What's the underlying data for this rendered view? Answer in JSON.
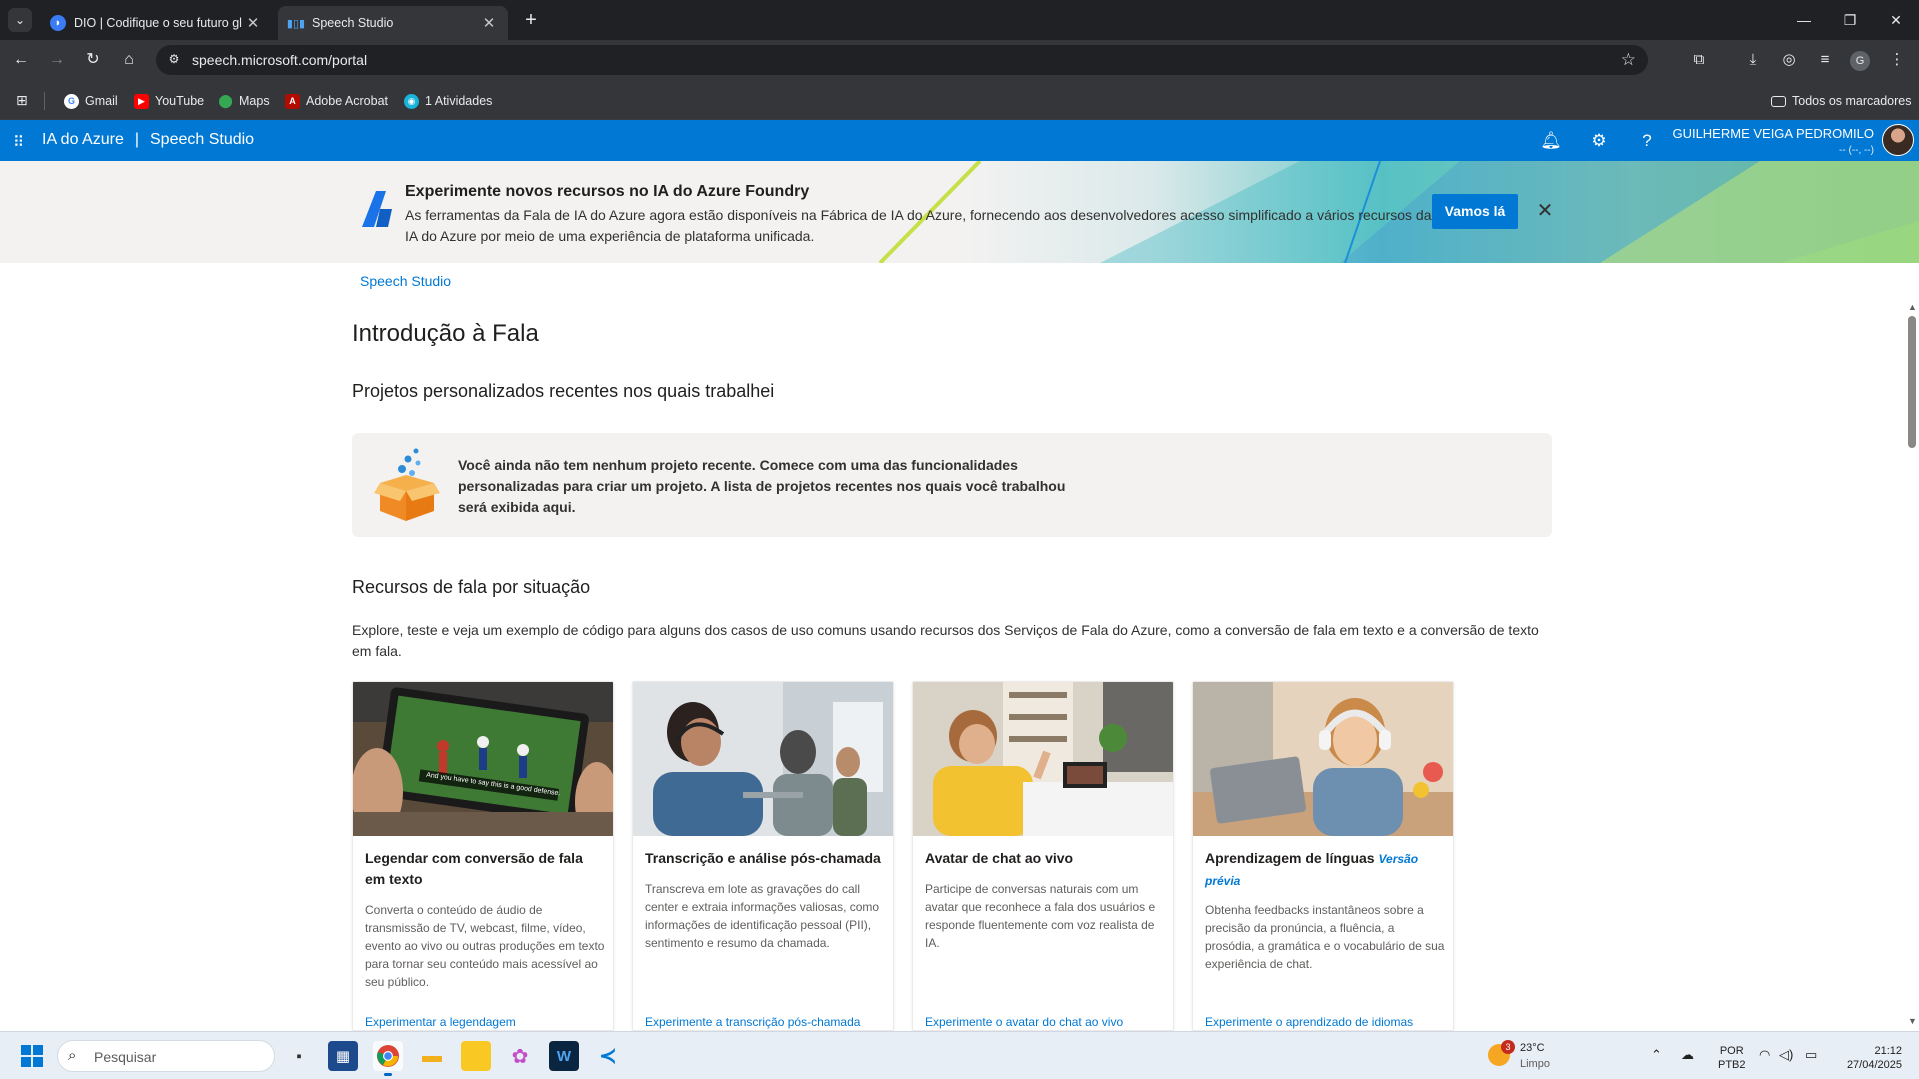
{
  "browser": {
    "tabs": [
      {
        "title": "DIO | Codifique o seu futuro gl"
      },
      {
        "title": "Speech Studio"
      }
    ],
    "url": "speech.microsoft.com/portal",
    "profile_initial": "G",
    "bookmarks": [
      "Gmail",
      "YouTube",
      "Maps",
      "Adobe Acrobat",
      "1 Atividades"
    ],
    "all_bookmarks": "Todos os marcadores"
  },
  "header": {
    "product": "IA do Azure",
    "separator": "|",
    "app": "Speech Studio",
    "user_name": "GUILHERME VEIGA PEDROMILO",
    "user_sub": "-- (--, --)"
  },
  "banner": {
    "title": "Experimente novos recursos no IA do Azure Foundry",
    "description": "As ferramentas da Fala de IA do Azure agora estão disponíveis na Fábrica de IA do Azure, fornecendo aos desenvolvedores acesso simplificado a vários recursos da IA do Azure por meio de uma experiência de plataforma unificada.",
    "cta": "Vamos lá"
  },
  "main": {
    "breadcrumb": "Speech Studio",
    "page_title": "Introdução à Fala",
    "recent_title": "Projetos personalizados recentes nos quais trabalhei",
    "recent_empty": "Você ainda não tem nenhum projeto recente. Comece com uma das funcionalidades personalizadas para criar um projeto. A lista de projetos recentes nos quais você trabalhou será exibida aqui.",
    "scenarios_title": "Recursos de fala por situação",
    "scenarios_desc": "Explore, teste e veja um exemplo de código para alguns dos casos de uso comuns usando recursos dos Serviços de Fala do Azure, como a conversão de fala em texto e a conversão de texto em fala.",
    "cards": [
      {
        "title": "Legendar com conversão de fala em texto",
        "preview": "",
        "description": "Converta o conteúdo de áudio de transmissão de TV, webcast, filme, vídeo, evento ao vivo ou outras produções em texto para tornar seu conteúdo mais acessível ao seu público.",
        "link": "Experimentar a legendagem",
        "image_caption": "And you have to say this is a good defense."
      },
      {
        "title": "Transcrição e análise pós-chamada",
        "preview": "",
        "description": "Transcreva em lote as gravações do call center e extraia informações valiosas, como informações de identificação pessoal (PII), sentimento e resumo da chamada.",
        "link": "Experimente a transcrição pós-chamada"
      },
      {
        "title": "Avatar de chat ao vivo",
        "preview": "",
        "description": "Participe de conversas naturais com um avatar que reconhece a fala dos usuários e responde fluentemente com voz realista de IA.",
        "link": "Experimente o avatar do chat ao vivo"
      },
      {
        "title": "Aprendizagem de línguas",
        "preview": "Versão prévia",
        "description": "Obtenha feedbacks instantâneos sobre a precisão da pronúncia, a fluência, a prosódia, a gramática e o vocabulário de sua experiência de chat.",
        "link": "Experimente o aprendizado de idiomas"
      }
    ]
  },
  "taskbar": {
    "search_placeholder": "Pesquisar",
    "weather_badge": "3",
    "weather_temp": "23°C",
    "weather_cond": "Limpo",
    "lang_1": "POR",
    "lang_2": "PTB2",
    "time": "21:12",
    "date": "27/04/2025"
  },
  "colors": {
    "azure_blue": "#0078d4",
    "chrome_dark": "#202124",
    "chrome_toolbar": "#35363a",
    "panel_gray": "#f3f2f1"
  }
}
